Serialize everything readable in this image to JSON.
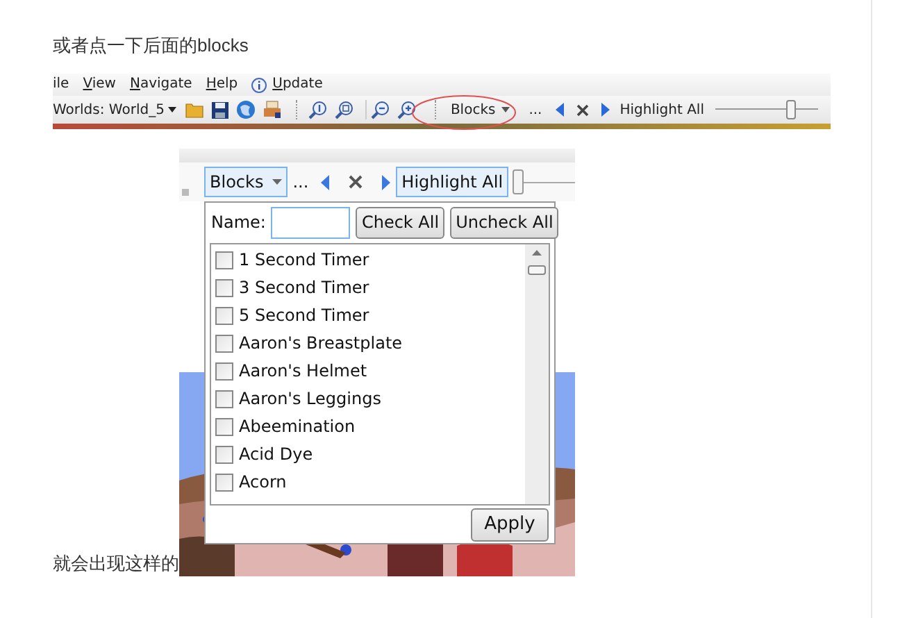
{
  "intro_text": "或者点一下后面的blocks",
  "screenshot_1": {
    "menu": [
      {
        "label": "ile",
        "access_key": false
      },
      {
        "label": "View",
        "access_key": true
      },
      {
        "label": "Navigate",
        "access_key": true
      },
      {
        "label": "Help",
        "access_key": true
      },
      {
        "label": "Update",
        "access_key": true
      }
    ],
    "world_selector": "Worlds: World_5",
    "search_dropdown": "Blocks",
    "ellipsis": "...",
    "highlight_label": "Highlight All",
    "slider": {
      "level": 0.73
    }
  },
  "screenshot_2": {
    "dropdown": "Blocks",
    "ellipsis": "...",
    "highlight_button": "Highlight All",
    "panel": {
      "name_label": "Name:",
      "buttons": [
        "Check All",
        "Uncheck All"
      ],
      "items": [
        {
          "label": "1 Second Timer",
          "checked": false
        },
        {
          "label": "3 Second Timer",
          "checked": false
        },
        {
          "label": "5 Second Timer",
          "checked": false
        },
        {
          "label": "Aaron's Breastplate",
          "checked": false
        },
        {
          "label": "Aaron's Helmet",
          "checked": false
        },
        {
          "label": "Aaron's Leggings",
          "checked": false
        },
        {
          "label": "Abeemination",
          "checked": false
        },
        {
          "label": "Acid Dye",
          "checked": false
        },
        {
          "label": "Acorn",
          "checked": false
        }
      ],
      "apply_button": "Apply"
    }
  },
  "caption_text": "就会出现这样的"
}
